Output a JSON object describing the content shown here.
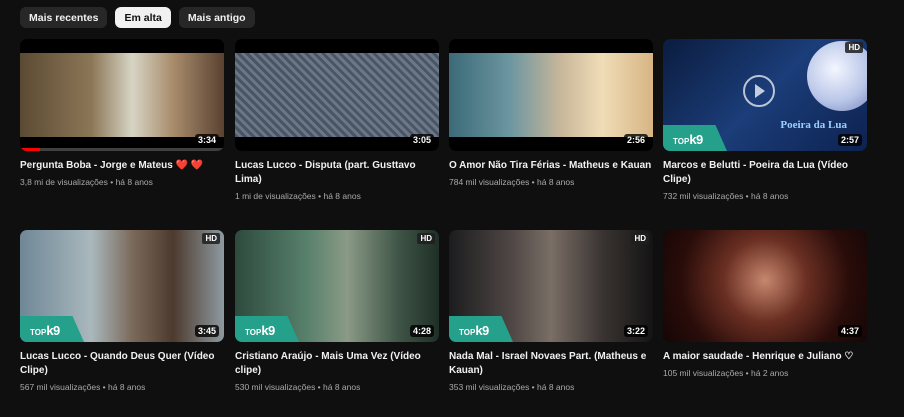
{
  "filters": [
    {
      "label": "Mais recentes",
      "active": false
    },
    {
      "label": "Em alta",
      "active": true
    },
    {
      "label": "Mais antigo",
      "active": false
    }
  ],
  "videos": [
    {
      "title": "Pergunta Boba - Jorge e Mateus ❤️ ❤️",
      "meta": "3,8 mi de visualizações • há 8 anos",
      "duration": "3:34",
      "hd": false,
      "progress": 0.1
    },
    {
      "title": "Lucas Lucco - Disputa (part. Gusttavo Lima)",
      "meta": "1 mi de visualizações • há 8 anos",
      "duration": "3:05",
      "hd": false,
      "progress": 0
    },
    {
      "title": "O Amor Não Tira Férias - Matheus e Kauan",
      "meta": "784 mil visualizações • há 8 anos",
      "duration": "2:56",
      "hd": false,
      "progress": 0
    },
    {
      "title": "Marcos e Belutti - Poeira da Lua (Vídeo Clipe)",
      "meta": "732 mil visualizações • há 8 anos",
      "duration": "2:57",
      "hd": true,
      "progress": 0,
      "overlay_text": "Poeira da Lua"
    },
    {
      "title": "Lucas Lucco - Quando Deus Quer (Vídeo Clipe)",
      "meta": "567 mil visualizações • há 8 anos",
      "duration": "3:45",
      "hd": true,
      "progress": 0
    },
    {
      "title": "Cristiano Araújo - Mais Uma Vez (Vídeo clipe)",
      "meta": "530 mil visualizações • há 8 anos",
      "duration": "4:28",
      "hd": true,
      "progress": 0
    },
    {
      "title": "Nada Mal - Israel Novaes Part. (Matheus e Kauan)",
      "meta": "353 mil visualizações • há 8 anos",
      "duration": "3:22",
      "hd": true,
      "progress": 0
    },
    {
      "title": "A maior saudade - Henrique e Juliano ♡",
      "meta": "105 mil visualizações • há 2 anos",
      "duration": "4:37",
      "hd": false,
      "progress": 0
    }
  ],
  "brand": {
    "top": "TOP",
    "k9": "k9"
  },
  "hd_label": "HD"
}
